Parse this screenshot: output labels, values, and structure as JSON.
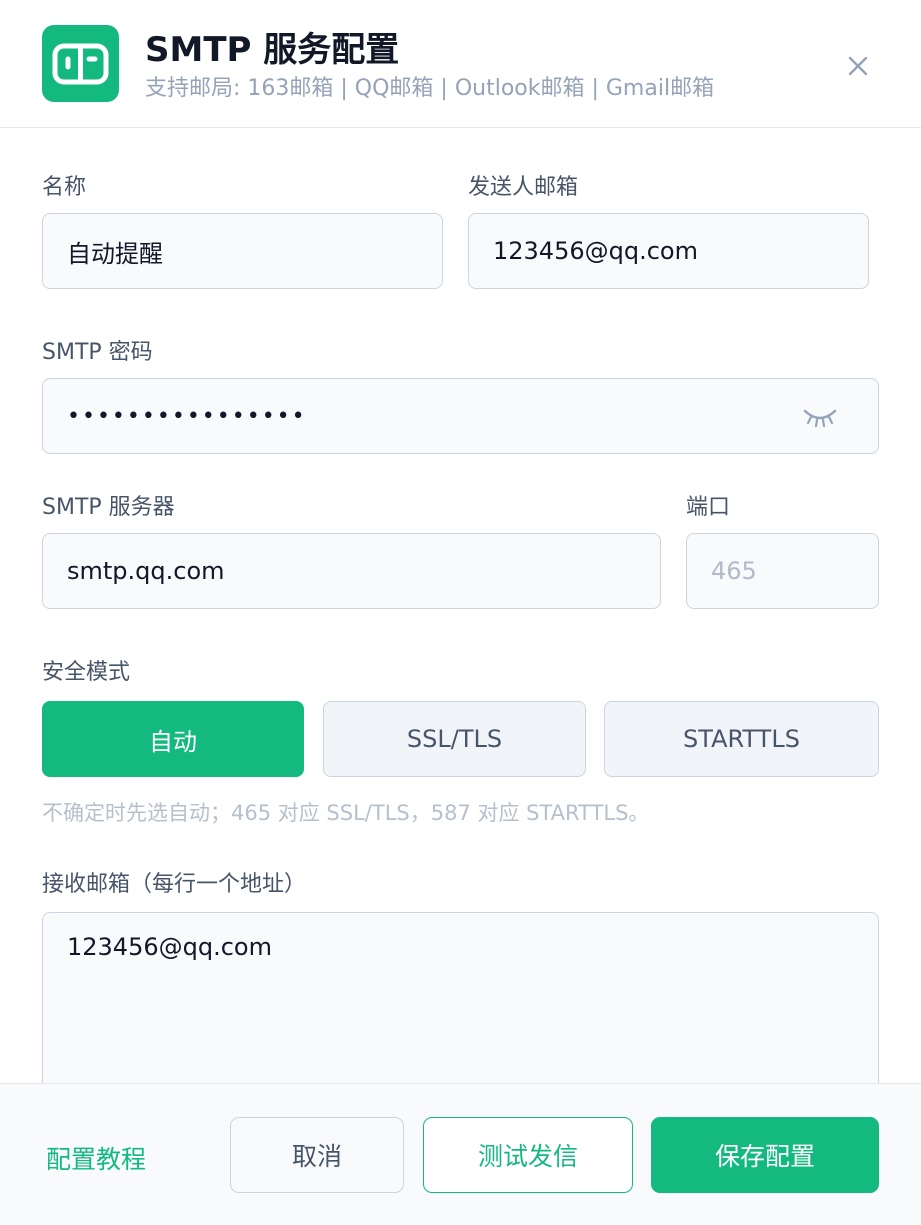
{
  "header": {
    "title": "SMTP 服务配置",
    "subtitle": "支持邮局: 163邮箱 | QQ邮箱 | Outlook邮箱 | Gmail邮箱"
  },
  "fields": {
    "name": {
      "label": "名称",
      "value": "自动提醒"
    },
    "sender": {
      "label": "发送人邮箱",
      "value": "123456@qq.com"
    },
    "password": {
      "label": "SMTP 密码",
      "value": "••••••••••••••••"
    },
    "server": {
      "label": "SMTP 服务器",
      "value": "smtp.qq.com"
    },
    "port": {
      "label": "端口",
      "placeholder": "465"
    }
  },
  "security": {
    "label": "安全模式",
    "options": [
      {
        "label": "自动",
        "selected": true
      },
      {
        "label": "SSL/TLS",
        "selected": false
      },
      {
        "label": "STARTTLS",
        "selected": false
      }
    ],
    "hint": "不确定时先选自动；465 对应 SSL/TLS，587 对应 STARTTLS。"
  },
  "recipients": {
    "label": "接收邮箱（每行一个地址）",
    "value": "123456@qq.com"
  },
  "footer": {
    "tutorial": "配置教程",
    "cancel": "取消",
    "test": "测试发信",
    "save": "保存配置"
  },
  "colors": {
    "accent": "#14b97f"
  },
  "icons": {
    "logo": "app-logo-icon",
    "close": "close-icon",
    "eye": "eye-closed-icon"
  }
}
